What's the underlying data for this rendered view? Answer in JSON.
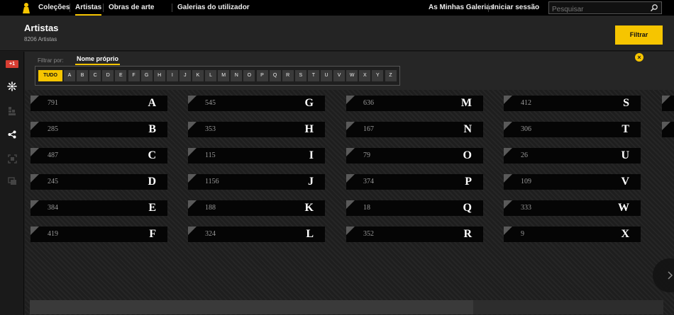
{
  "nav": {
    "items": [
      "Coleções",
      "Artistas",
      "Obras de arte",
      "Galerias do utilizador"
    ],
    "active": "Artistas",
    "right_items": [
      "As Minhas Galerias",
      "Iniciar sessão"
    ],
    "search_placeholder": "Pesquisar"
  },
  "header": {
    "title": "Artistas",
    "subtitle": "8206 Artistas",
    "filter_button": "Filtrar"
  },
  "sidebar": {
    "gplus_label": "+1",
    "icons": [
      "google-plus-icon",
      "sparkle-icon",
      "building-icon",
      "share-icon",
      "fullscreen-icon",
      "gallery-icon"
    ]
  },
  "filter": {
    "label": "Filtrar por:",
    "tab": "Nome próprio",
    "all_label": "TUDO",
    "letters": [
      "A",
      "B",
      "C",
      "D",
      "E",
      "F",
      "G",
      "H",
      "I",
      "J",
      "K",
      "L",
      "M",
      "N",
      "O",
      "P",
      "Q",
      "R",
      "S",
      "T",
      "U",
      "V",
      "W",
      "X",
      "Y",
      "Z"
    ]
  },
  "tiles": [
    {
      "letter": "A",
      "count": "791"
    },
    {
      "letter": "B",
      "count": "285"
    },
    {
      "letter": "C",
      "count": "487"
    },
    {
      "letter": "D",
      "count": "245"
    },
    {
      "letter": "E",
      "count": "384"
    },
    {
      "letter": "F",
      "count": "419"
    },
    {
      "letter": "G",
      "count": "545"
    },
    {
      "letter": "H",
      "count": "353"
    },
    {
      "letter": "I",
      "count": "115"
    },
    {
      "letter": "J",
      "count": "1156"
    },
    {
      "letter": "K",
      "count": "188"
    },
    {
      "letter": "L",
      "count": "324"
    },
    {
      "letter": "M",
      "count": "636"
    },
    {
      "letter": "N",
      "count": "167"
    },
    {
      "letter": "O",
      "count": "79"
    },
    {
      "letter": "P",
      "count": "374"
    },
    {
      "letter": "Q",
      "count": "18"
    },
    {
      "letter": "R",
      "count": "352"
    },
    {
      "letter": "S",
      "count": "412"
    },
    {
      "letter": "T",
      "count": "306"
    },
    {
      "letter": "U",
      "count": "26"
    },
    {
      "letter": "V",
      "count": "109"
    },
    {
      "letter": "W",
      "count": "333"
    },
    {
      "letter": "X",
      "count": "9"
    }
  ],
  "colors": {
    "accent": "#f6c500",
    "tile_bg": "#050505",
    "nav_bg": "#000000"
  }
}
